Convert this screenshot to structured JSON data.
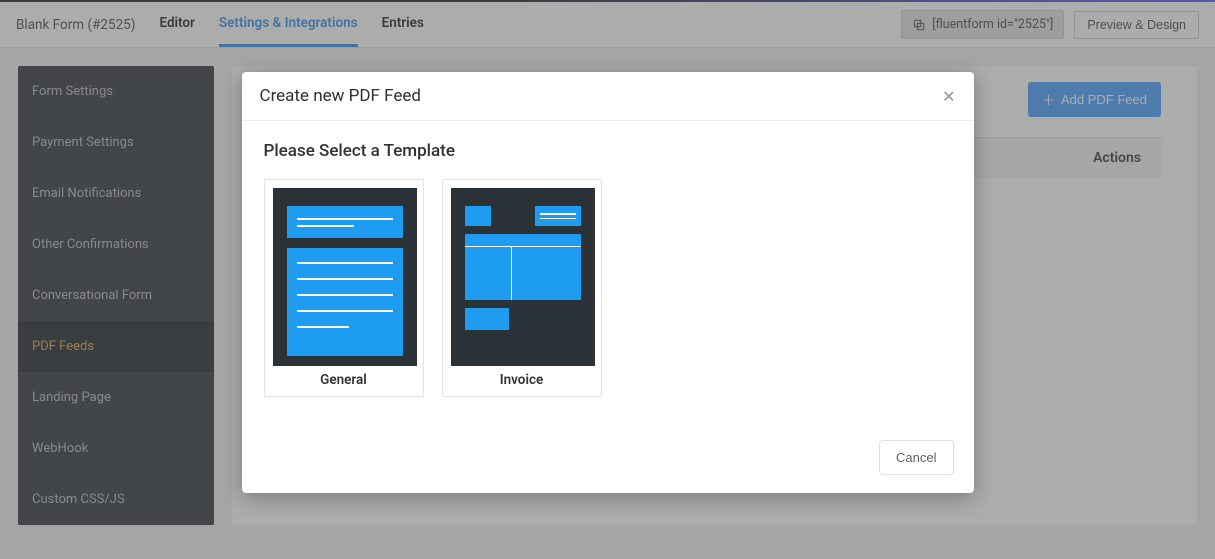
{
  "header": {
    "title": "Blank Form (#2525)",
    "tabs": [
      "Editor",
      "Settings & Integrations",
      "Entries"
    ],
    "activeTab": 1,
    "shortcode": "[fluentform id=\"2525\"]",
    "preview_btn": "Preview & Design"
  },
  "sidebar": {
    "items": [
      "Form Settings",
      "Payment Settings",
      "Email Notifications",
      "Other Confirmations",
      "Conversational Form",
      "PDF Feeds",
      "Landing Page",
      "WebHook",
      "Custom CSS/JS"
    ],
    "activeIndex": 5
  },
  "main": {
    "add_btn": "Add PDF Feed",
    "actions_label": "Actions"
  },
  "modal": {
    "title": "Create new PDF Feed",
    "subtitle": "Please Select a Template",
    "templates": [
      {
        "label": "General"
      },
      {
        "label": "Invoice"
      }
    ],
    "cancel": "Cancel"
  }
}
